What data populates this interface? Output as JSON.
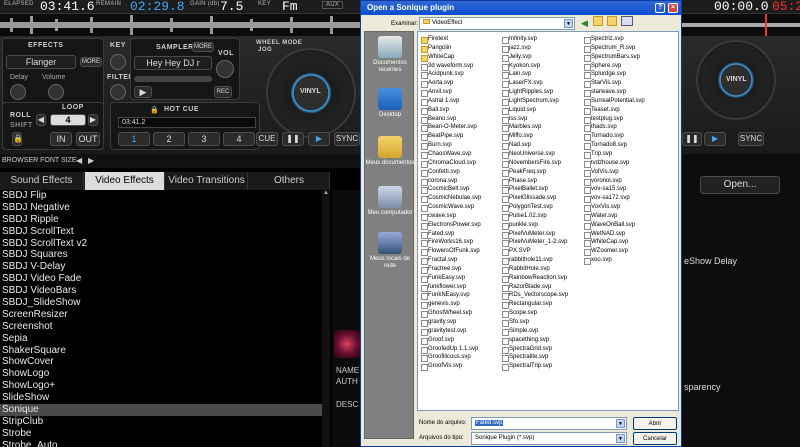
{
  "topbar": {
    "elapsed_label": "ELAPSED",
    "elapsed": "03:41.6",
    "remain_label": "REMAIN",
    "remain": "02:29.8",
    "gain_label": "GAIN (db)",
    "gain": "7.5",
    "key_label": "KEY",
    "key": "Fm",
    "aux": "AUX",
    "right_time": "00:00.0",
    "right_time2": "05:2"
  },
  "deck": {
    "effects_label": "EFFECTS",
    "effect_value": "Flanger",
    "more1": "MORE",
    "delay": "Delay",
    "volume": "Volume",
    "key_label": "KEY",
    "filter_label": "FILTER",
    "sampler_label": "SAMPLER",
    "more2": "MORE",
    "sampler_value": "Hey Hey DJ r",
    "vol_label": "VOL",
    "rec": "REC",
    "wheel_mode": "WHEEL MODE",
    "jog": "JOG",
    "vinyl": "VINYL",
    "loop_label": "LOOP",
    "roll": "ROLL",
    "shift": "SHIFT",
    "loop_value": "4",
    "in": "IN",
    "out": "OUT",
    "hot_cue_label": "HOT CUE",
    "hot_cue_time": "03:41.2",
    "cues": [
      "1",
      "2",
      "3",
      "4"
    ],
    "cue": "CUE",
    "sync": "SYNC",
    "right_cue": "CUE",
    "right_sync": "SYNC",
    "right_vinyl": "VINYL"
  },
  "browser": {
    "font_size_label": "BROWSER FONT SIZE",
    "tabs": [
      "Sound Effects",
      "Video Effects",
      "Video Transitions",
      "Others"
    ],
    "active_tab": 1,
    "items": [
      "SBDJ Flip",
      "SBDJ Negative",
      "SBDJ Ripple",
      "SBDJ ScrollText",
      "SBDJ ScrollText v2",
      "SBDJ Squares",
      "SBDJ V-Delay",
      "SBDJ Video Fade",
      "SBDJ VideoBars",
      "SBDJ_SlideShow",
      "ScreenResizer",
      "Screenshot",
      "Sepia",
      "ShakerSquare",
      "ShowCover",
      "ShowLogo",
      "ShowLogo+",
      "SlideShow",
      "Sonique",
      "StripClub",
      "Strobe",
      "Strobe_Auto",
      "T3"
    ],
    "selected_item": 18,
    "info_name": "NAME",
    "info_auth": "AUTH",
    "info_desc": "DESC",
    "open_button": "Open...",
    "right_text1": "eShow Delay",
    "right_text2": "sparency"
  },
  "dialog": {
    "title": "Open a Sonique plugin",
    "look_in_label": "Examinar:",
    "look_in_value": "VideoEffect",
    "places": [
      "Documentos recentes",
      "Desktop",
      "Meus documentos",
      "Meu computador",
      "Meus locais de rede"
    ],
    "folders": [
      "Firetext",
      "Pangolin",
      "WhiteCap"
    ],
    "col1": [
      "3d waveform.svp",
      "Acidpunk.svp",
      "Aorta.svp",
      "Anvil.svp",
      "Astral 1.svp",
      "Ball.svp",
      "Beano.svp",
      "Bean-O-Meter.svp",
      "BeatPipe.svp",
      "Burn.svp",
      "ChaosWave.svp",
      "ChromaCloud.svp",
      "Confetti.svp",
      "corona.svp",
      "CosmicBelt.svp",
      "CosmicNebulae.svp",
      "CosmicWave.svp",
      "cwave.svp",
      "ElectronsPower.svp",
      "Fated.svp",
      "FireWorks16.svp",
      "FlowersOfFunk.svp",
      "Fractal.svp",
      "Fractree.svp",
      "FunkEasy.svp",
      "funkflower.svp",
      "FunkNEasy.svp",
      "genevis.svp",
      "GhostWheel.svp",
      "gravity.svp",
      "gravitytest.svp",
      "Groof.svp",
      "GroofedUp 1.1.svp",
      "Groofilicous.svp",
      "GroofVis.svp"
    ],
    "col2": [
      "Infinity.svp",
      "jazz.svp",
      "Jelly.svp",
      "Kyokon.svp",
      "Lain.svp",
      "LaserFX.svp",
      "LightRipples.svp",
      "LightSpectrum.svp",
      "Liquid.svp",
      "lss.svp",
      "Marbles.svp",
      "Miffo.svp",
      "Nad.svp",
      "NeoUniverse.svp",
      "NovembersFire.svp",
      "PeakFreq.svp",
      "Phase.svp",
      "PixelBallet.svp",
      "PixelGlissade.svp",
      "PolygonTest.svp",
      "Pulse1.02.svp",
      "punkle.svp",
      "PixelVuMeter.svp",
      "PixelVuMeter_1-2.svp",
      "PX.SVP",
      "rabbithole11.svp",
      "RabbitHole.svp",
      "RainbowReaction.svp",
      "RazorBlade.svp",
      "RDs_Vectorscope.svp",
      "Rectangular.svp",
      "Scope.svp",
      "Sfo.svp",
      "Simple.svp",
      "spacething.svp",
      "SpectraGrid.svp",
      "Spectralite.svp",
      "SpectralTrip.svp"
    ],
    "col3": [
      "Spectriz.svp",
      "Spectrum_R.svp",
      "SpectrumBars.svp",
      "Sphere.svp",
      "Splurdge.svp",
      "StarVis.svp",
      "starwave.svp",
      "SurrealPotential.svp",
      "Teaset.svp",
      "testplug.svp",
      "thads.svp",
      "Tornado.svp",
      "Tornado8.svp",
      "Trip.svp",
      "tvdzhouse.svp",
      "VolVis.svp",
      "voronoi.svp",
      "vov-sa15.svp",
      "vov-sa172.svp",
      "VoxVis.svp",
      "Water.svp",
      "WaveOnBall.svp",
      "WetNAD.svp",
      "WhiteCap.svp",
      "WZoomer.svp",
      "xoo.svp"
    ],
    "filename_label": "Nome do arquivo:",
    "filename_value": "Fated.svp",
    "filetype_label": "Arquivos do tipo:",
    "filetype_value": "Sonique Plugin (*.svp)",
    "open_btn": "Abrir",
    "cancel_btn": "Cancelar"
  }
}
